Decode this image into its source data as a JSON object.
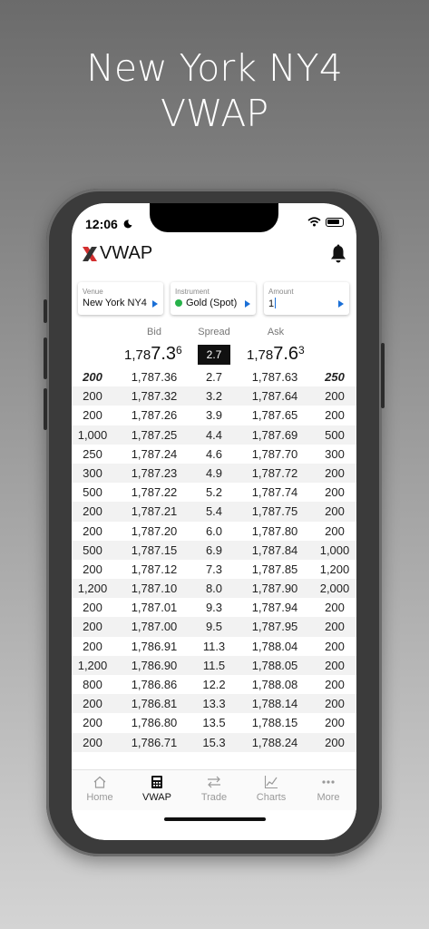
{
  "promo": {
    "line1": "New York NY4",
    "line2": "VWAP"
  },
  "status_bar": {
    "time": "12:06"
  },
  "header": {
    "title": "VWAP"
  },
  "selectors": [
    {
      "label": "Venue",
      "value": "New York NY4"
    },
    {
      "label": "Instrument",
      "value": "Gold (Spot)",
      "status_color": "#27b24a"
    },
    {
      "label": "Amount",
      "value": "1"
    }
  ],
  "columns": {
    "bid": "Bid",
    "spread": "Spread",
    "ask": "Ask"
  },
  "top_of_book": {
    "bid": {
      "prefix": "1,78",
      "big": "7.3",
      "pip": "6"
    },
    "spread": "2.7",
    "ask": {
      "prefix": "1,78",
      "big": "7.6",
      "pip": "3"
    }
  },
  "rows": [
    [
      "200",
      "1,787.36",
      "2.7",
      "1,787.63",
      "250"
    ],
    [
      "200",
      "1,787.32",
      "3.2",
      "1,787.64",
      "200"
    ],
    [
      "200",
      "1,787.26",
      "3.9",
      "1,787.65",
      "200"
    ],
    [
      "1,000",
      "1,787.25",
      "4.4",
      "1,787.69",
      "500"
    ],
    [
      "250",
      "1,787.24",
      "4.6",
      "1,787.70",
      "300"
    ],
    [
      "300",
      "1,787.23",
      "4.9",
      "1,787.72",
      "200"
    ],
    [
      "500",
      "1,787.22",
      "5.2",
      "1,787.74",
      "200"
    ],
    [
      "200",
      "1,787.21",
      "5.4",
      "1,787.75",
      "200"
    ],
    [
      "200",
      "1,787.20",
      "6.0",
      "1,787.80",
      "200"
    ],
    [
      "500",
      "1,787.15",
      "6.9",
      "1,787.84",
      "1,000"
    ],
    [
      "200",
      "1,787.12",
      "7.3",
      "1,787.85",
      "1,200"
    ],
    [
      "1,200",
      "1,787.10",
      "8.0",
      "1,787.90",
      "2,000"
    ],
    [
      "200",
      "1,787.01",
      "9.3",
      "1,787.94",
      "200"
    ],
    [
      "200",
      "1,787.00",
      "9.5",
      "1,787.95",
      "200"
    ],
    [
      "200",
      "1,786.91",
      "11.3",
      "1,788.04",
      "200"
    ],
    [
      "1,200",
      "1,786.90",
      "11.5",
      "1,788.05",
      "200"
    ],
    [
      "800",
      "1,786.86",
      "12.2",
      "1,788.08",
      "200"
    ],
    [
      "200",
      "1,786.81",
      "13.3",
      "1,788.14",
      "200"
    ],
    [
      "200",
      "1,786.80",
      "13.5",
      "1,788.15",
      "200"
    ],
    [
      "200",
      "1,786.71",
      "15.3",
      "1,788.24",
      "200"
    ]
  ],
  "tabs": [
    {
      "label": "Home",
      "icon": "home-icon",
      "active": false
    },
    {
      "label": "VWAP",
      "icon": "calculator-icon",
      "active": true
    },
    {
      "label": "Trade",
      "icon": "swap-arrows-icon",
      "active": false
    },
    {
      "label": "Charts",
      "icon": "line-chart-icon",
      "active": false
    },
    {
      "label": "More",
      "icon": "more-dots-icon",
      "active": false
    }
  ],
  "colors": {
    "accent": "#1a6fd6",
    "status_green": "#27b24a",
    "logo_red": "#d32f2f"
  }
}
